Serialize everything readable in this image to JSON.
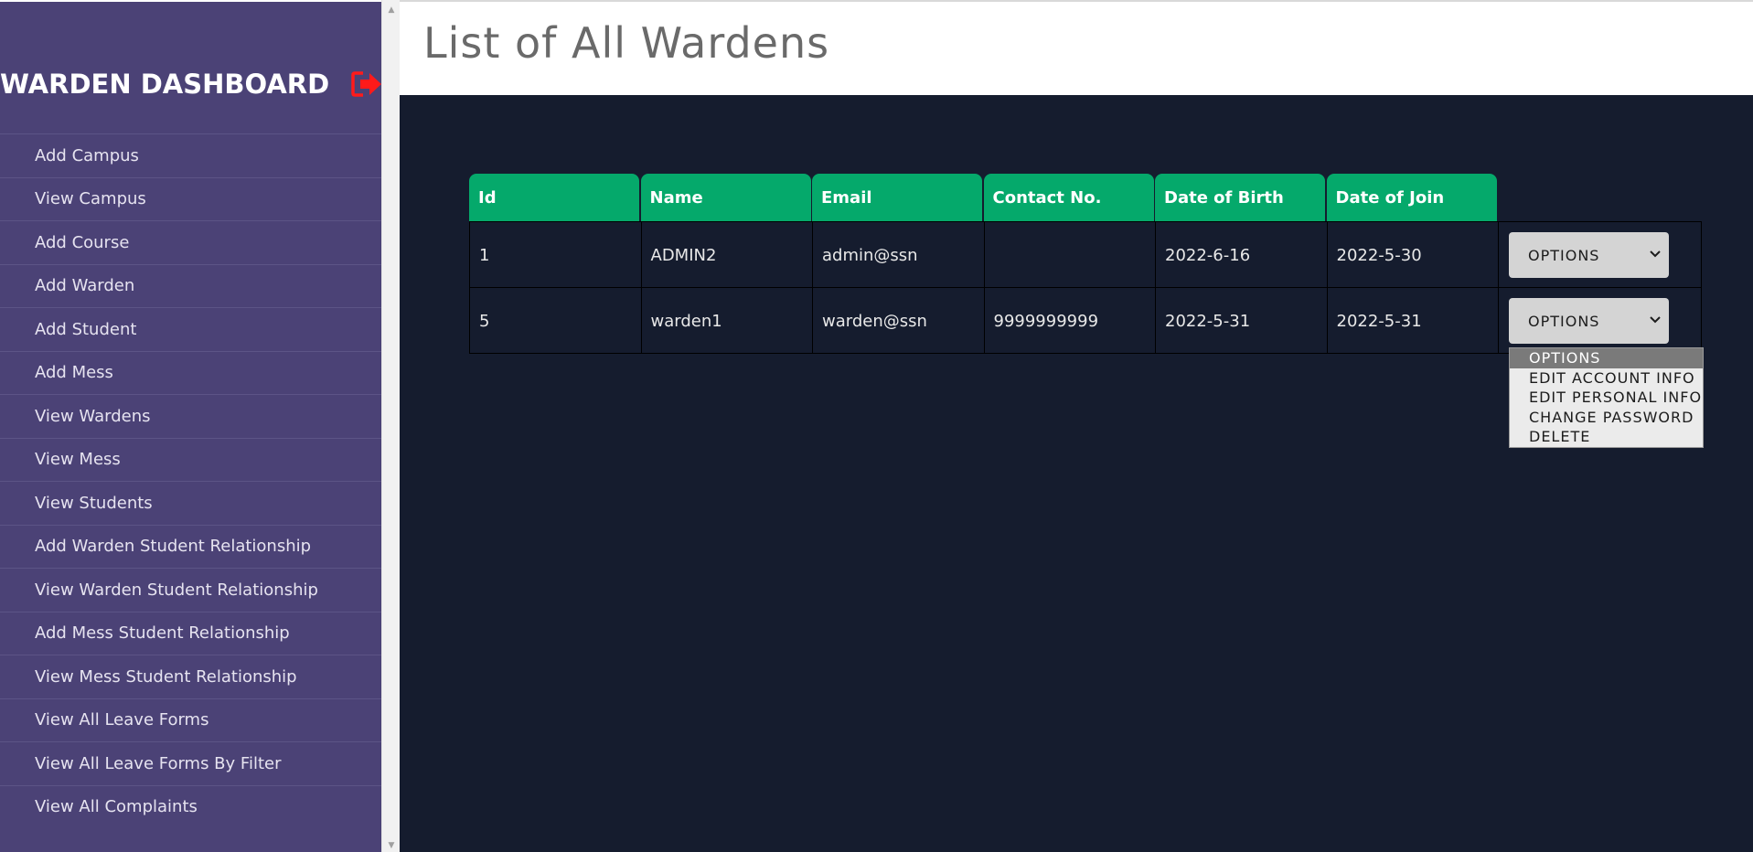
{
  "sidebar": {
    "title": "WARDEN DASHBOARD",
    "logout_icon": "logout-icon",
    "accent_color": "#ff1a1a",
    "items": [
      {
        "label": "Add Campus"
      },
      {
        "label": "View Campus"
      },
      {
        "label": "Add Course"
      },
      {
        "label": "Add Warden"
      },
      {
        "label": "Add Student"
      },
      {
        "label": "Add Mess"
      },
      {
        "label": "View Wardens"
      },
      {
        "label": "View Mess"
      },
      {
        "label": "View Students"
      },
      {
        "label": "Add Warden Student Relationship"
      },
      {
        "label": "View Warden Student Relationship"
      },
      {
        "label": "Add Mess Student Relationship"
      },
      {
        "label": "View Mess Student Relationship"
      },
      {
        "label": "View All Leave Forms"
      },
      {
        "label": "View All Leave Forms By Filter"
      },
      {
        "label": "View All Complaints"
      }
    ]
  },
  "header": {
    "title": "List of All Wardens"
  },
  "table": {
    "header_color": "#05a96b",
    "columns": [
      "Id",
      "Name",
      "Email",
      "Contact No.",
      "Date of Birth",
      "Date of Join"
    ],
    "rows": [
      {
        "id": "1",
        "name": "ADMIN2",
        "email": "admin@ssn",
        "contact": "",
        "dob": "2022-6-16",
        "doj": "2022-5-30",
        "select_value": "OPTIONS"
      },
      {
        "id": "5",
        "name": "warden1",
        "email": "warden@ssn",
        "contact": "9999999999",
        "dob": "2022-5-31",
        "doj": "2022-5-31",
        "select_value": "OPTIONS"
      }
    ]
  },
  "dropdown": {
    "options": [
      "OPTIONS",
      "EDIT ACCOUNT INFO",
      "EDIT PERSONAL INFO",
      "CHANGE PASSWORD",
      "DELETE"
    ],
    "selected": "OPTIONS"
  }
}
